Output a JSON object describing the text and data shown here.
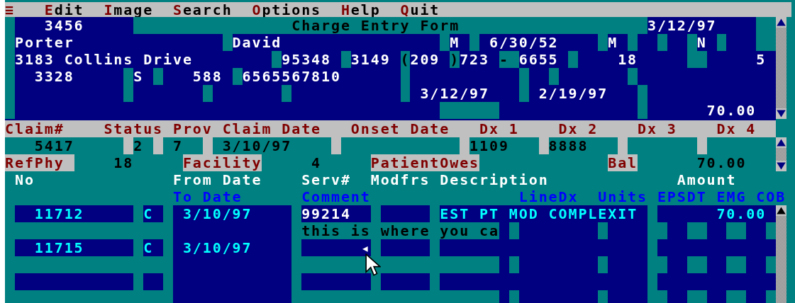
{
  "menu": [
    {
      "label": "≡"
    },
    {
      "label": "Edit"
    },
    {
      "label": "Image"
    },
    {
      "label": "Search"
    },
    {
      "label": "Options"
    },
    {
      "label": "Help"
    },
    {
      "label": "Quit"
    }
  ],
  "form": {
    "title": "Charge Entry Form",
    "fields": [
      {
        "text": "3456"
      },
      {
        "text": "3/12/97"
      },
      {
        "text": "Porter"
      },
      {
        "text": "David"
      },
      {
        "text": "M"
      },
      {
        "text": "6/30/52"
      },
      {
        "text": "M"
      },
      {
        "text": "N"
      },
      {
        "text": "3183 Collins Drive"
      },
      {
        "text": "95348"
      },
      {
        "text": "3149"
      },
      {
        "text": "("
      },
      {
        "text": "209"
      },
      {
        "text": ")"
      },
      {
        "text": "723"
      },
      {
        "text": "-"
      },
      {
        "text": "6655"
      },
      {
        "text": "18"
      },
      {
        "text": "5"
      },
      {
        "text": "3328"
      },
      {
        "text": "S"
      },
      {
        "text": "588"
      },
      {
        "text": "6565567810"
      },
      {
        "text": "3/12/97"
      },
      {
        "text": "2/19/97"
      },
      {
        "text": "70.00"
      }
    ]
  },
  "claim": {
    "labels": [
      "Claim#",
      "Status",
      "Prov",
      "Claim Date",
      "Onset Date",
      "Dx 1",
      "Dx 2",
      "Dx 3",
      "Dx 4"
    ],
    "values": [
      "5417",
      "2",
      "7",
      "3/10/97",
      "1109",
      "8888"
    ]
  },
  "totals": {
    "labels": [
      "RefPhy",
      "Facility",
      "PatientOwes",
      "Bal"
    ],
    "values": [
      "18",
      "4",
      "70.00"
    ]
  },
  "line_columns": {
    "first_row": [
      "No",
      "From Date",
      "Serv#",
      "Modfrs",
      "Description",
      "Amount"
    ],
    "second_row": [
      "To Date",
      "Comment",
      "LineDx",
      "Units",
      "EPSDT",
      "EMG",
      "COB"
    ]
  },
  "line_items": [
    {
      "number": "11712",
      "status": "C",
      "from_date": "3/10/97",
      "service": "99214",
      "description": "EST PT MOD COMPLEXIT",
      "amount": "70.00",
      "comment": "this is where you ca"
    },
    {
      "number": "11715",
      "status": "C",
      "from_date": "3/10/97",
      "marker": "◂"
    }
  ]
}
